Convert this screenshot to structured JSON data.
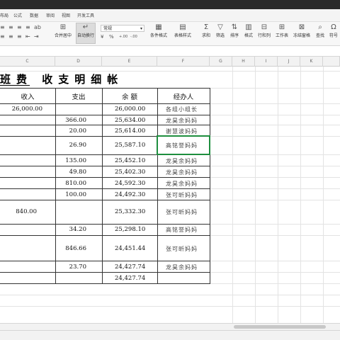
{
  "menu": [
    "布局",
    "公式",
    "数据",
    "审阅",
    "视图",
    "开发工具"
  ],
  "ribbon": {
    "merge_label": "合并居中",
    "wrap_label": "自动换行",
    "number_format": "常规",
    "currency_symbol": "¥",
    "percent_symbol": "%",
    "decimal_inc": "+.00",
    "decimal_dec": "-.00",
    "cond_format_label": "条件格式",
    "table_style_label": "表格样式",
    "sum_label": "求和",
    "filter_label": "筛选",
    "sort_label": "排序",
    "format_label": "格式",
    "rowcol_label": "行和列",
    "sheet_label": "工作表",
    "freeze_label": "冻结窗格",
    "find_label": "查找",
    "symbol_label": "符号"
  },
  "columns": [
    "C",
    "D",
    "E",
    "F",
    "G",
    "H",
    "I",
    "J",
    "K"
  ],
  "sheet": {
    "title": "班费 收支明细帐",
    "headers": [
      "收入",
      "支出",
      "余 额",
      "经办人"
    ],
    "rows": [
      {
        "income": "26,000.00",
        "expense": "",
        "balance": "26,000.00",
        "handler": "各组小组长"
      },
      {
        "income": "",
        "expense": "366.00",
        "balance": "25,634.00",
        "handler": "龙昊余妈妈"
      },
      {
        "income": "",
        "expense": "20.00",
        "balance": "25,614.00",
        "handler": "谢慧波妈妈"
      },
      {
        "income": "",
        "expense": "26.90",
        "balance": "25,587.10",
        "handler": "高铭誉妈妈"
      },
      {
        "income": "",
        "expense": "135.00",
        "balance": "25,452.10",
        "handler": "龙昊余妈妈"
      },
      {
        "income": "",
        "expense": "49.80",
        "balance": "25,402.30",
        "handler": "龙昊余妈妈"
      },
      {
        "income": "",
        "expense": "810.00",
        "balance": "24,592.30",
        "handler": "龙昊余妈妈"
      },
      {
        "income": "",
        "expense": "100.00",
        "balance": "24,492.30",
        "handler": "张可昕妈妈"
      },
      {
        "income": "840.00",
        "expense": "",
        "balance": "25,332.30",
        "handler": "张可昕妈妈"
      },
      {
        "income": "",
        "expense": "34.20",
        "balance": "25,298.10",
        "handler": "高铭誉妈妈"
      },
      {
        "income": "",
        "expense": "846.66",
        "balance": "24,451.44",
        "handler": "张可昕妈妈"
      },
      {
        "income": "",
        "expense": "23.70",
        "balance": "24,427.74",
        "handler": "龙昊余妈妈"
      },
      {
        "income": "",
        "expense": "",
        "balance": "24,427.74",
        "handler": ""
      }
    ]
  }
}
